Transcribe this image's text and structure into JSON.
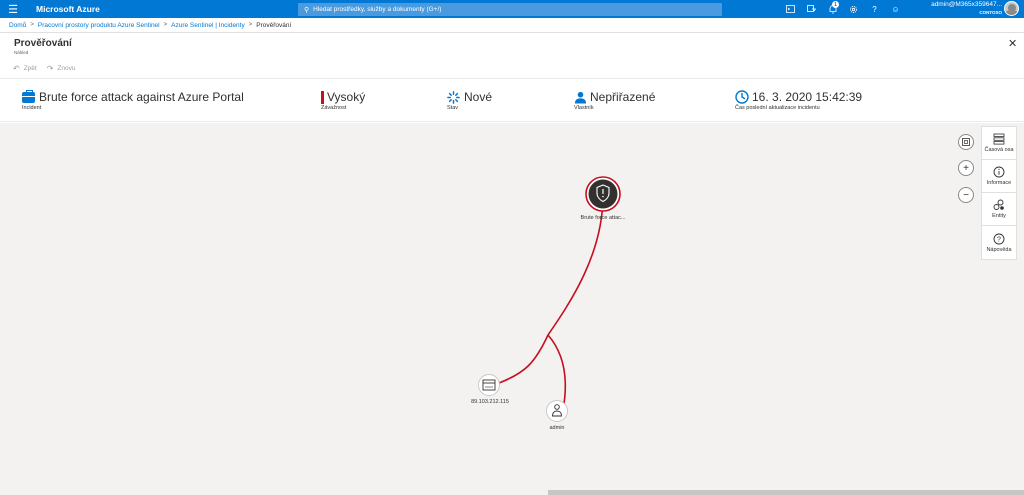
{
  "topbar": {
    "brand": "Microsoft Azure",
    "search_placeholder": "Hledat prostředky, služby a dokumenty (G+/)",
    "notification_count": "1",
    "account_name": "admin@M365x359647...",
    "tenant": "CONTOSO",
    "icons": [
      "cloud-shell-icon",
      "directory-filter-icon",
      "notifications-icon",
      "settings-icon",
      "help-icon",
      "feedback-icon"
    ]
  },
  "breadcrumb": [
    {
      "label": "Domů",
      "link": true
    },
    {
      "label": "Pracovní prostory produktu Azure Sentinel",
      "link": true
    },
    {
      "label": "Azure Sentinel | Incidenty",
      "link": true
    },
    {
      "label": "Prověřování",
      "link": false
    }
  ],
  "blade": {
    "title": "Prověřování",
    "subtitle": "Náhled"
  },
  "commands": {
    "undo": "Zpět",
    "redo": "Znovu"
  },
  "incident": {
    "title": "Brute force attack against Azure Portal",
    "title_label": "Incident",
    "severity": "Vysoký",
    "severity_label": "Závažnost",
    "status": "Nové",
    "status_label": "Stav",
    "owner": "Nepřiřazené",
    "owner_label": "Vlastník",
    "updated": "16. 3. 2020 15:42:39",
    "updated_label": "Čas poslední aktualizace incidentu"
  },
  "graph": {
    "nodes": {
      "alert": "Brute force attac...",
      "ip": "89.103.212.115",
      "account": "admin"
    }
  },
  "side_panel": {
    "timeline": "Časová osa",
    "info": "Informace",
    "entities": "Entity",
    "help": "Nápověda"
  },
  "colors": {
    "azure_blue": "#0078d4",
    "severity_high": "#c50f1f",
    "edge": "#c50f1f"
  }
}
